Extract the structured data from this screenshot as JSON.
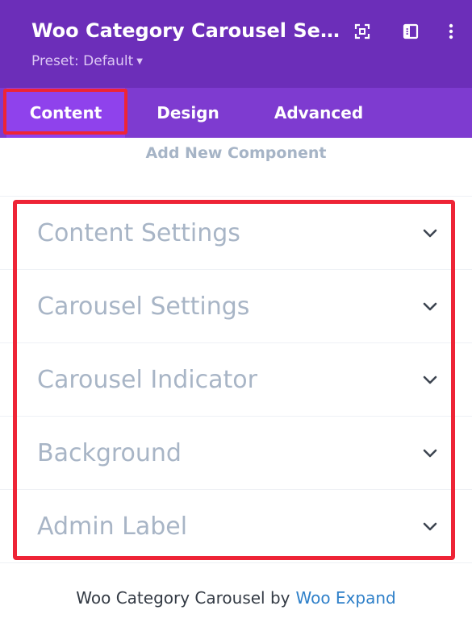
{
  "header": {
    "title": "Woo Category Carousel Set...",
    "preset_label": "Preset: Default",
    "icons": [
      "expand-icon",
      "sidebar-layout-icon",
      "more-options-icon"
    ]
  },
  "tabs": [
    {
      "label": "Content",
      "active": true
    },
    {
      "label": "Design",
      "active": false
    },
    {
      "label": "Advanced",
      "active": false
    }
  ],
  "add_component_label": "Add New Component",
  "toggles": [
    {
      "label": "Content Settings"
    },
    {
      "label": "Carousel Settings"
    },
    {
      "label": "Carousel Indicator"
    },
    {
      "label": "Background"
    },
    {
      "label": "Admin Label"
    }
  ],
  "footer": {
    "prefix": "Woo Category Carousel by",
    "link_text": "Woo Expand"
  },
  "colors": {
    "header_bg": "#6c2eb9",
    "tabs_bg": "#7e3bd0",
    "active_tab_bg": "#8f42ec",
    "highlight_red": "#ee2436",
    "link_blue": "#2f80c9"
  }
}
